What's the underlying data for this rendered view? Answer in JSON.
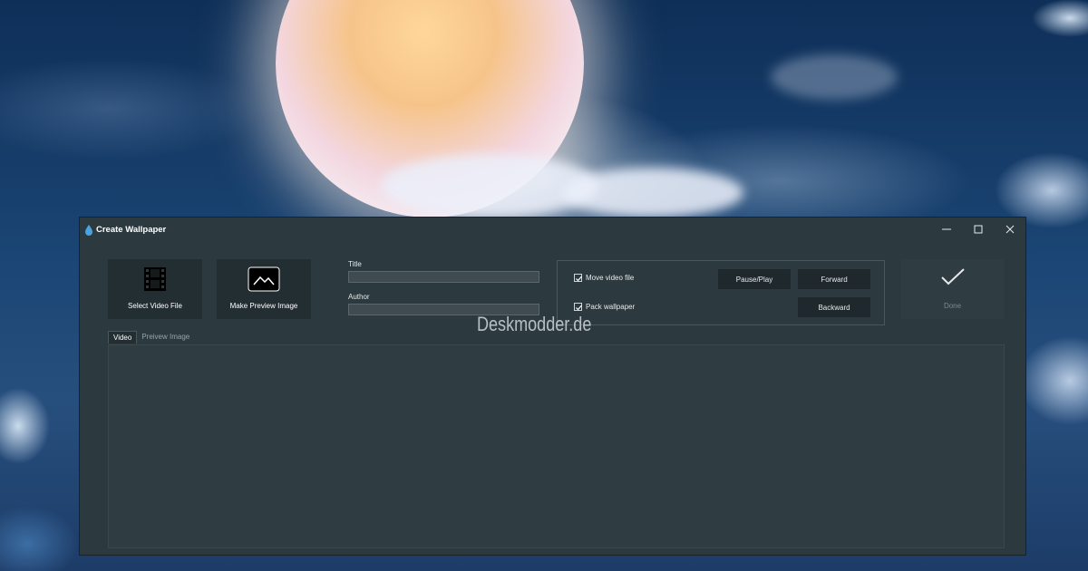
{
  "window": {
    "title": "Create Wallpaper"
  },
  "toolbar": {
    "select_video_label": "Select Video File",
    "make_preview_label": "Make Preview Image"
  },
  "form": {
    "title_label": "Title",
    "title_value": "",
    "author_label": "Author",
    "author_value": ""
  },
  "options": {
    "move_video_label": "Move video file",
    "move_video_checked": true,
    "pack_wallpaper_label": "Pack wallpaper",
    "pack_wallpaper_checked": true
  },
  "controls": {
    "pause_play_label": "Pause/Play",
    "forward_label": "Forward",
    "backward_label": "Backward"
  },
  "done": {
    "label": "Done"
  },
  "tabs": [
    {
      "label": "Video",
      "active": true
    },
    {
      "label": "Preivew Image",
      "active": false
    }
  ],
  "watermark": {
    "text": "Deskmodder.de"
  },
  "icons": {
    "app": "droplet-icon",
    "select_video": "film-icon",
    "make_preview": "image-icon",
    "done": "checkmark-icon",
    "minimize": "minimize-icon",
    "maximize": "maximize-icon",
    "close": "close-icon"
  },
  "colors": {
    "window_bg": "#2c3a40",
    "tile_bg": "#232e33",
    "accent_drop": "#4aa3e0"
  }
}
